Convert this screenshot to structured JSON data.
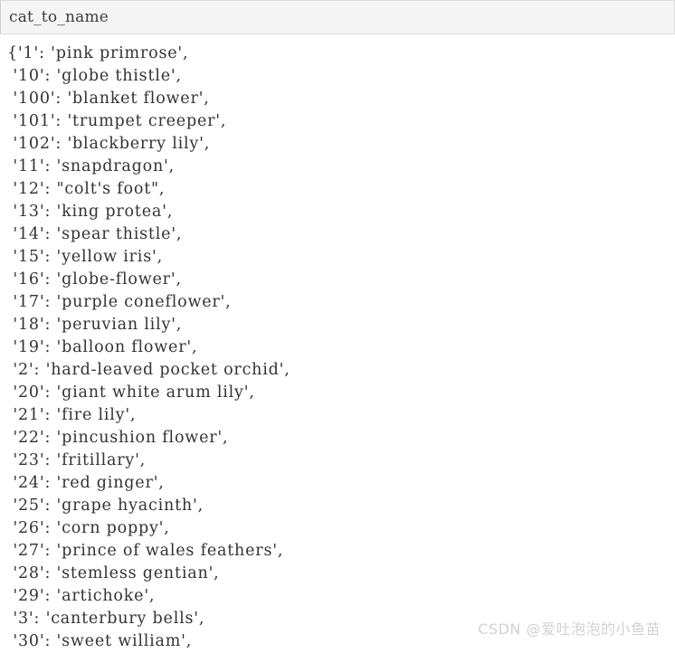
{
  "header": {
    "title": "cat_to_name",
    "background_color": "#f5f5f5",
    "border_color": "#dcdcdc"
  },
  "output": {
    "background_color": "#ffffff",
    "text_color": "#333333",
    "lines": [
      "{'1': 'pink primrose',",
      " '10': 'globe thistle',",
      " '100': 'blanket flower',",
      " '101': 'trumpet creeper',",
      " '102': 'blackberry lily',",
      " '11': 'snapdragon',",
      " '12': \"colt's foot\",",
      " '13': 'king protea',",
      " '14': 'spear thistle',",
      " '15': 'yellow iris',",
      " '16': 'globe-flower',",
      " '17': 'purple coneflower',",
      " '18': 'peruvian lily',",
      " '19': 'balloon flower',",
      " '2': 'hard-leaved pocket orchid',",
      " '20': 'giant white arum lily',",
      " '21': 'fire lily',",
      " '22': 'pincushion flower',",
      " '23': 'fritillary',",
      " '24': 'red ginger',",
      " '25': 'grape hyacinth',",
      " '26': 'corn poppy',",
      " '27': 'prince of wales feathers',",
      " '28': 'stemless gentian',",
      " '29': 'artichoke',",
      " '3': 'canterbury bells',",
      " '30': 'sweet william',"
    ]
  },
  "watermark": {
    "text": "CSDN @爱吐泡泡的小鱼苗",
    "color": "#d2d2d2"
  }
}
